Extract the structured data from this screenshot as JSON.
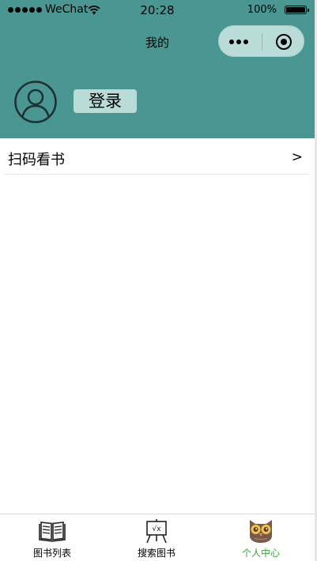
{
  "status_bar": {
    "carrier": "WeChat",
    "time": "20:28",
    "battery": "100%",
    "battery_level": 1.0
  },
  "nav": {
    "title": "我的"
  },
  "profile": {
    "login_label": "登录"
  },
  "menu": {
    "items": [
      {
        "label": "扫码看书",
        "arrow": ">"
      }
    ]
  },
  "tabbar": {
    "tabs": [
      {
        "label": "图书列表",
        "icon": "book-icon"
      },
      {
        "label": "搜索图书",
        "icon": "easel-icon"
      },
      {
        "label": "个人中心",
        "icon": "owl-icon",
        "active": true
      }
    ]
  },
  "colors": {
    "header_bg": "#4a9692",
    "accent": "#b9dcd9",
    "active_tab": "#3ea33e"
  }
}
